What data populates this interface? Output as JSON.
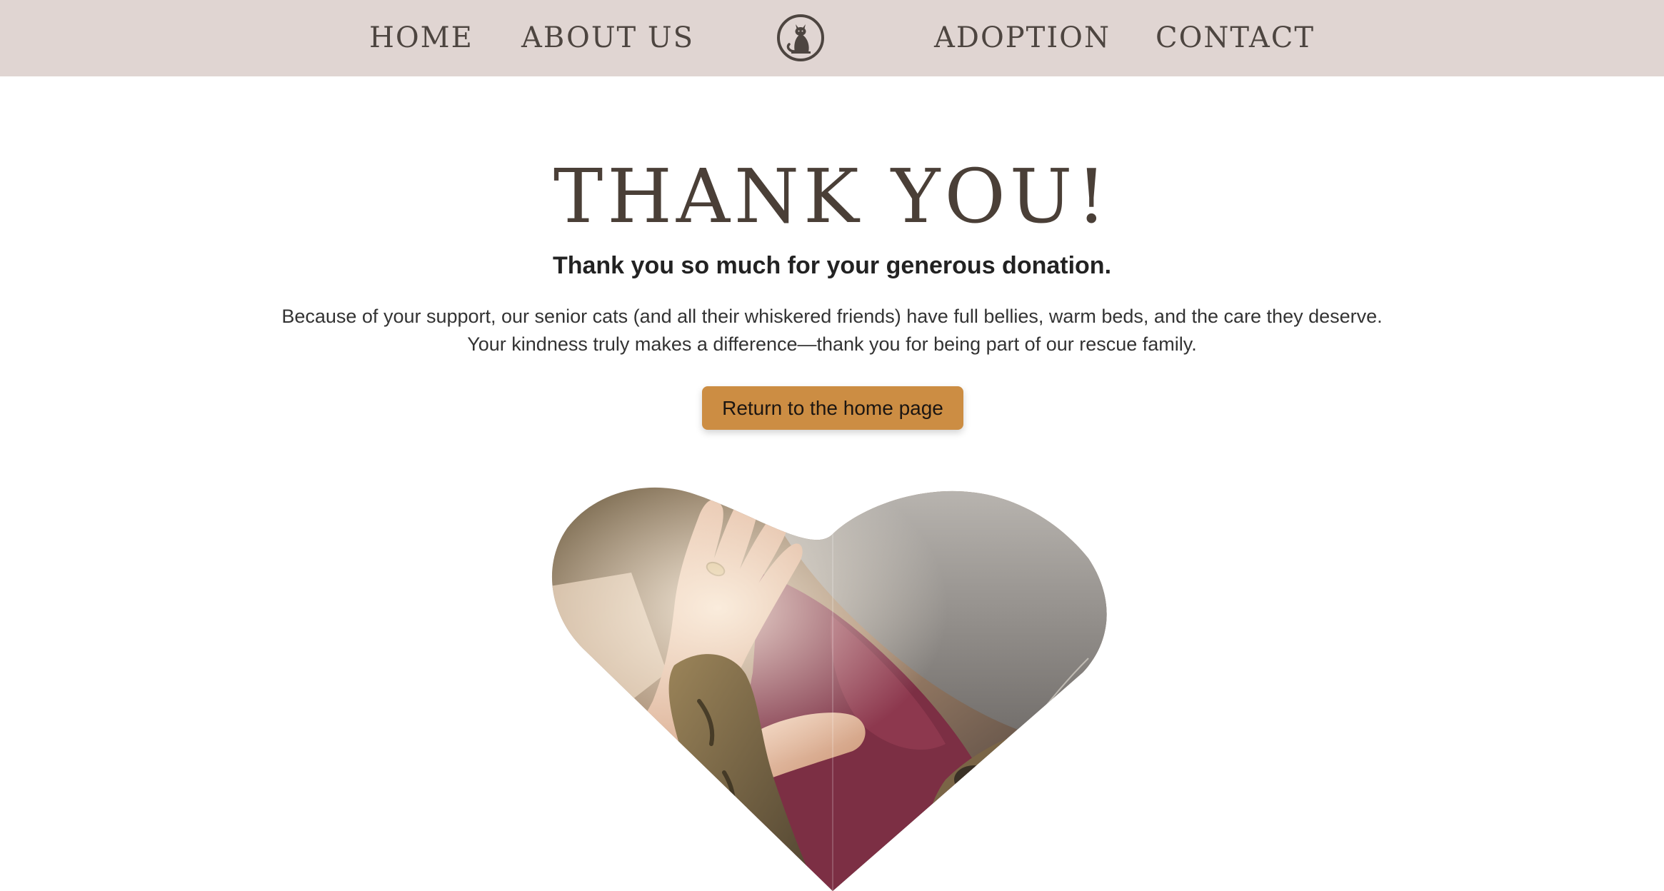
{
  "nav": {
    "home": "HOME",
    "about": "ABOUT US",
    "adoption": "ADOPTION",
    "contact": "CONTACT",
    "logo_icon": "cat-logo-icon"
  },
  "main": {
    "headline": "THANK YOU!",
    "subhead": "Thank you so much for your generous donation.",
    "body_line_1": "Because of your support, our senior cats (and all their whiskered friends) have full bellies, warm beds, and the care they deserve.",
    "body_line_2": "Your kindness truly makes a difference—thank you for being part of our rescue family.",
    "cta_label": "Return to the home page"
  },
  "colors": {
    "nav_bg": "#e0d5d2",
    "nav_text": "#4d4540",
    "headline": "#4a3f37",
    "cta_bg": "#cc8d43"
  }
}
